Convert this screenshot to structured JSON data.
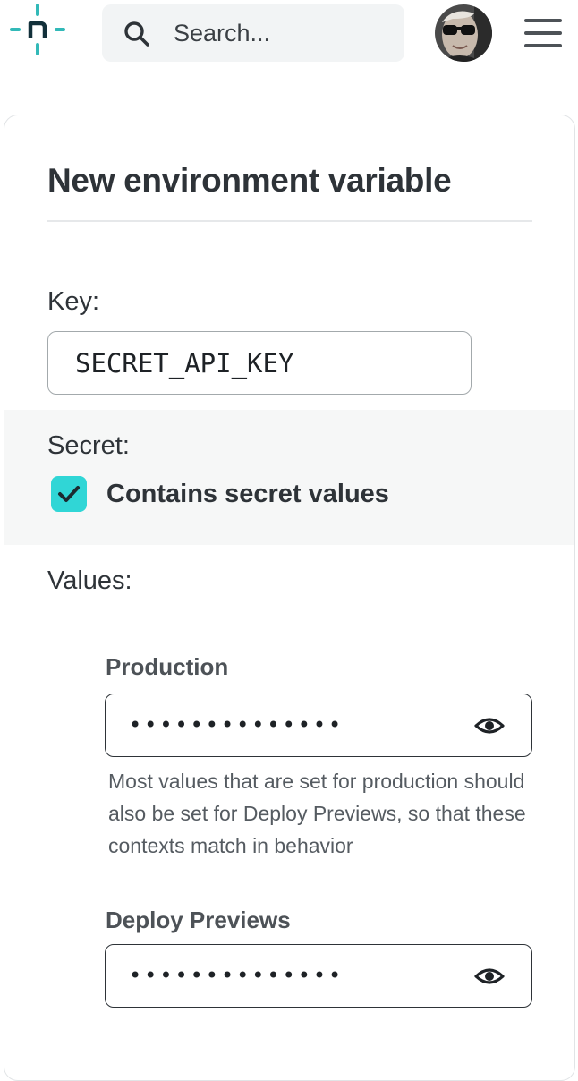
{
  "header": {
    "logo_icon": "netlify-logo-icon",
    "search_placeholder": "Search...",
    "search_icon": "search-icon",
    "avatar": "user-avatar",
    "menu_icon": "hamburger-menu-icon"
  },
  "form": {
    "title": "New environment variable",
    "key_label": "Key:",
    "key_value": "SECRET_API_KEY",
    "secret_label": "Secret:",
    "secret_checkbox_label": "Contains secret values",
    "secret_checked": true,
    "values_label": "Values:",
    "contexts": [
      {
        "label": "Production",
        "value": "••••••••••••••",
        "reveal_icon": "eye-icon",
        "help": "Most values that are set for production should also be set for Deploy Previews, so that these contexts match in behavior"
      },
      {
        "label": "Deploy Previews",
        "value": "••••••••••••••",
        "reveal_icon": "eye-icon"
      }
    ]
  },
  "colors": {
    "accent": "#30d6d6",
    "logo_teal": "#32b9b8",
    "text": "#2e3338",
    "secret_bg": "#f6f7f7",
    "search_bg": "#f2f4f5"
  }
}
